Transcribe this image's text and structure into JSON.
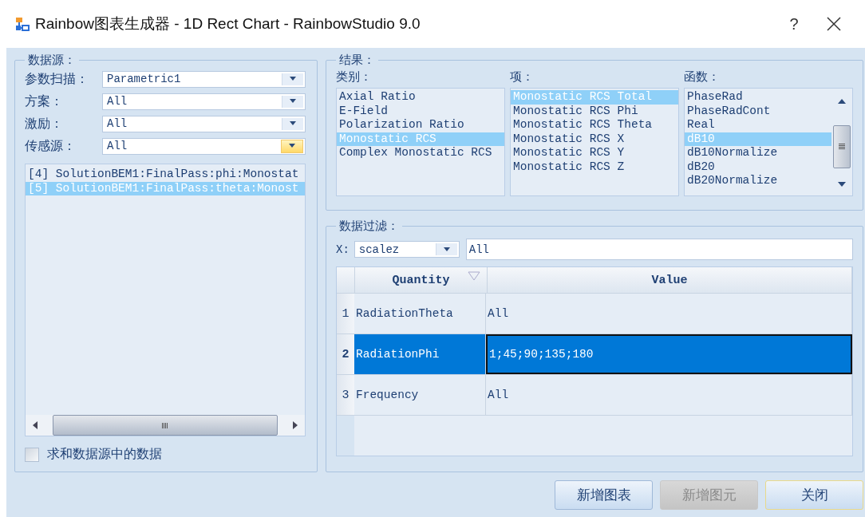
{
  "window": {
    "title": "Rainbow图表生成器 - 1D Rect Chart - RainbowStudio 9.0",
    "help": "?"
  },
  "data_source": {
    "legend": "数据源：",
    "fields": [
      {
        "label": "参数扫描：",
        "value": "Parametric1",
        "hovered": false
      },
      {
        "label": "方案：",
        "value": "All",
        "hovered": false
      },
      {
        "label": "激励：",
        "value": "All",
        "hovered": false
      },
      {
        "label": "传感源：",
        "value": "All",
        "hovered": true
      }
    ],
    "list": [
      {
        "text": "[4] SolutionBEM1:FinalPass:phi:Monostat",
        "selected": false
      },
      {
        "text": "[5] SolutionBEM1:FinalPass:theta:Monost",
        "selected": true
      }
    ],
    "sum_checkbox": {
      "label": "求和数据源中的数据",
      "checked": false
    }
  },
  "results": {
    "legend": "结果：",
    "lists": [
      {
        "label": "类别：",
        "scrollbar": false,
        "items": [
          {
            "text": "Axial Ratio",
            "selected": false
          },
          {
            "text": "E-Field",
            "selected": false
          },
          {
            "text": "Polarization Ratio",
            "selected": false
          },
          {
            "text": "Monostatic RCS",
            "selected": true
          },
          {
            "text": "Complex Monostatic RCS",
            "selected": false
          }
        ]
      },
      {
        "label": "项：",
        "scrollbar": false,
        "items": [
          {
            "text": "Monostatic RCS Total",
            "selected": true
          },
          {
            "text": "Monostatic RCS Phi",
            "selected": false
          },
          {
            "text": "Monostatic RCS Theta",
            "selected": false
          },
          {
            "text": "Monostatic RCS X",
            "selected": false
          },
          {
            "text": "Monostatic RCS Y",
            "selected": false
          },
          {
            "text": "Monostatic RCS Z",
            "selected": false
          }
        ]
      },
      {
        "label": "函数：",
        "scrollbar": true,
        "items": [
          {
            "text": "PhaseRad",
            "selected": false
          },
          {
            "text": "PhaseRadCont",
            "selected": false
          },
          {
            "text": "Real",
            "selected": false
          },
          {
            "text": "dB10",
            "selected": true
          },
          {
            "text": "dB10Normalize",
            "selected": false
          },
          {
            "text": "dB20",
            "selected": false
          },
          {
            "text": "dB20Normalize",
            "selected": false
          }
        ]
      }
    ]
  },
  "filter": {
    "legend": "数据过滤：",
    "x_label": "X:",
    "x_combo": "scalez",
    "x_value": "All",
    "table": {
      "columns": [
        "Quantity",
        "Value"
      ],
      "rows": [
        {
          "number": "1",
          "quantity": "RadiationTheta",
          "value": "All",
          "selected": false
        },
        {
          "number": "2",
          "quantity": "RadiationPhi",
          "value": "1;45;90;135;180",
          "selected": true
        },
        {
          "number": "3",
          "quantity": "Frequency",
          "value": "All",
          "selected": false
        }
      ]
    }
  },
  "buttons": [
    {
      "label": "新增图表",
      "disabled": false,
      "focused": false
    },
    {
      "label": "新增图元",
      "disabled": true,
      "focused": false
    },
    {
      "label": "关闭",
      "disabled": false,
      "focused": true
    }
  ]
}
